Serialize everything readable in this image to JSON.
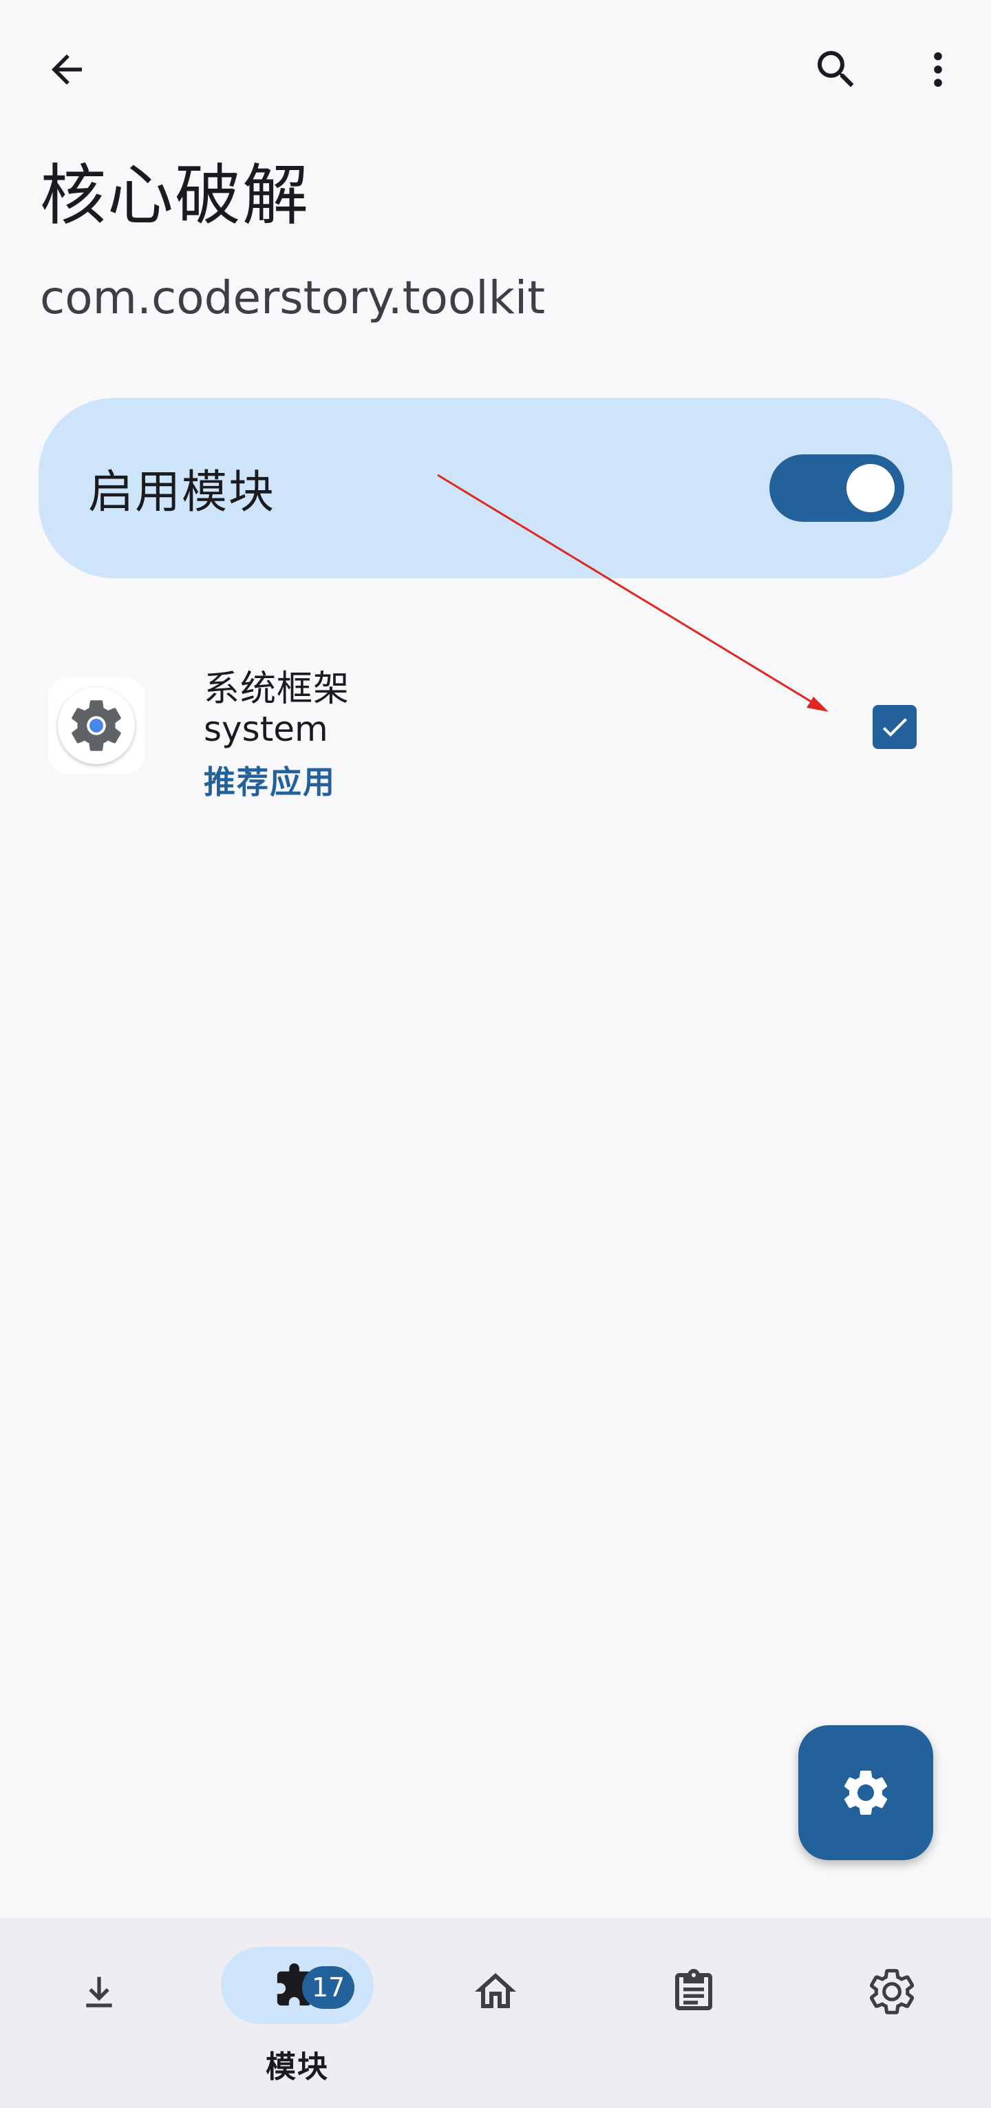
{
  "app_bar": {
    "back_icon": "arrow-back-icon",
    "search_icon": "search-icon",
    "more_icon": "more-vert-icon"
  },
  "header": {
    "title": "核心破解",
    "subtitle": "com.coderstory.toolkit"
  },
  "enable_card": {
    "label": "启用模块",
    "enabled": true
  },
  "modules": [
    {
      "name": "系统框架",
      "package": "system",
      "tag": "推荐应用",
      "checked": true,
      "icon": "gear-icon"
    }
  ],
  "fab": {
    "icon": "gear-icon"
  },
  "bottom_nav": {
    "items": [
      {
        "id": "download",
        "icon": "download-icon",
        "label": ""
      },
      {
        "id": "modules",
        "icon": "puzzle-icon",
        "label": "模块",
        "badge": "17",
        "active": true
      },
      {
        "id": "home",
        "icon": "home-icon",
        "label": ""
      },
      {
        "id": "logs",
        "icon": "clipboard-icon",
        "label": ""
      },
      {
        "id": "settings",
        "icon": "gear-icon",
        "label": ""
      }
    ]
  },
  "colors": {
    "primary": "#23619a",
    "card_bg": "#cde4fb",
    "background": "#f8f8fb",
    "nav_bg": "#ededf2",
    "annotation": "#e0261f"
  }
}
